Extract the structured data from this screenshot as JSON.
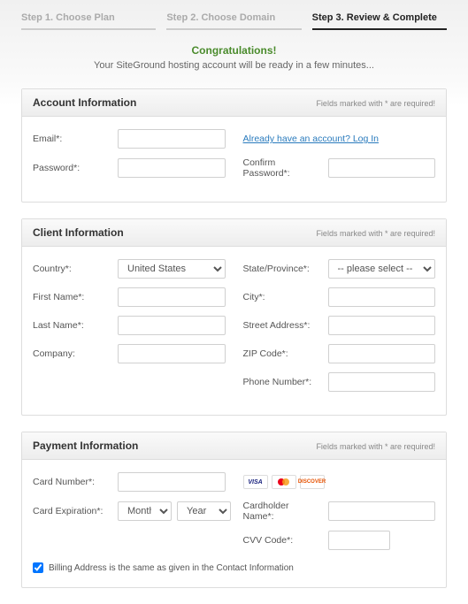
{
  "steps": {
    "s1": "Step 1. Choose Plan",
    "s2": "Step 2. Choose Domain",
    "s3": "Step 3. Review & Complete"
  },
  "congrats": {
    "title": "Congratulations!",
    "subtitle": "Your SiteGround hosting account will be ready in a few minutes..."
  },
  "required_note": "Fields marked with * are required!",
  "account": {
    "title": "Account Information",
    "email_label": "Email*:",
    "login_link": "Already have an account? Log In",
    "password_label": "Password*:",
    "confirm_label": "Confirm Password*:"
  },
  "client": {
    "title": "Client Information",
    "country_label": "Country*:",
    "country_value": "United States",
    "state_label": "State/Province*:",
    "state_value": "-- please select --",
    "firstname_label": "First Name*:",
    "city_label": "City*:",
    "lastname_label": "Last Name*:",
    "street_label": "Street Address*:",
    "company_label": "Company:",
    "zip_label": "ZIP Code*:",
    "phone_label": "Phone Number*:"
  },
  "payment": {
    "title": "Payment Information",
    "cardnum_label": "Card Number*:",
    "exp_label": "Card Expiration*:",
    "exp_month": "Month",
    "exp_year": "Year",
    "cardholder_label": "Cardholder Name*:",
    "cvv_label": "CVV Code*:",
    "billing_same": "Billing Address is the same as given in the Contact Information",
    "cards": {
      "visa": "VISA",
      "discover": "DISCOVER"
    }
  }
}
